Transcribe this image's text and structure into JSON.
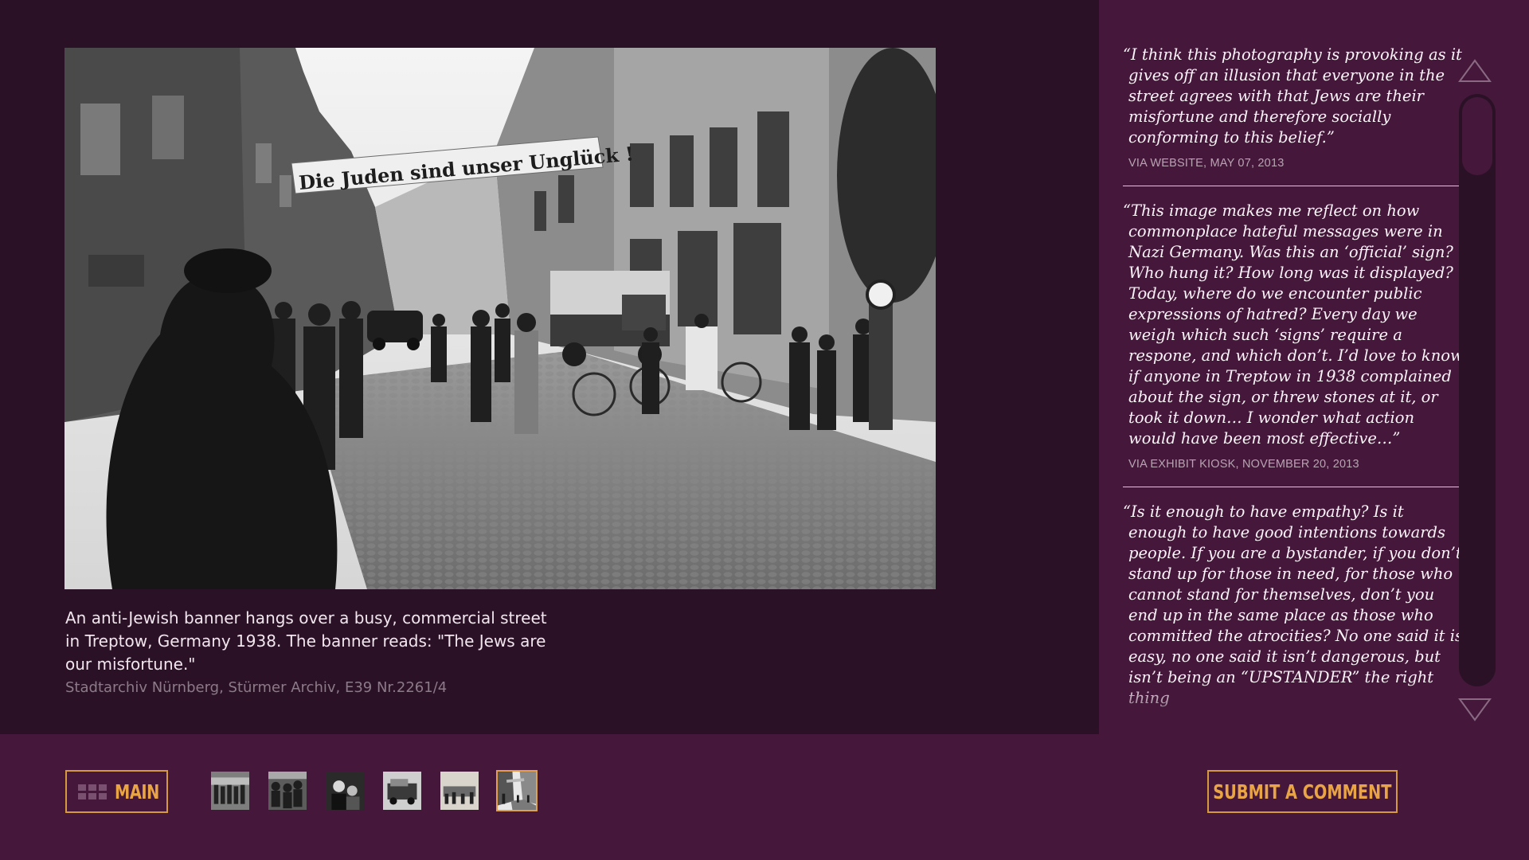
{
  "photo": {
    "banner_text": "Die Juden sind unser Unglück !"
  },
  "caption": {
    "text": "An anti-Jewish banner hangs over a busy, commercial street in Treptow, Germany 1938.  The banner reads: \"The Jews are our misfortune.\"",
    "credit": "Stadtarchiv Nürnberg, Stürmer Archiv, E39 Nr.2261/4"
  },
  "comments": [
    {
      "text": "“I think this photography is provoking as it gives off an illusion that everyone in the street agrees with that Jews are their misfortune and therefore socially conforming to this belief.”",
      "meta": "VIA WEBSITE, MAY 07, 2013"
    },
    {
      "text": "“This image makes me reflect on how commonplace hateful messages were in Nazi Germany. Was this an ‘official’ sign? Who hung it? How long was it displayed? Today, where do we encounter public expressions of hatred? Every day we weigh which such ‘signs’ require a respone, and which don’t. I’d love to know if anyone in Treptow in 1938 complained about the sign, or threw stones at it, or took it down… I wonder what action would have been most effective…”",
      "meta": "VIA EXHIBIT KIOSK, NOVEMBER 20, 2013"
    },
    {
      "text": "“Is it enough to have empathy? Is it enough to have good intentions towards people. If you are a bystander, if you don’t stand up for those in need, for those who cannot stand for themselves, don’t you end up in the same place as those who committed the atrocities? No one said it is easy, no one said it isn’t dangerous, but isn’t being an “UPSTANDER” the right thing",
      "meta": ""
    }
  ],
  "scroll": {
    "position": 0.0
  },
  "bottom_bar": {
    "main_label": "MAIN",
    "submit_label": "SUBMIT A COMMENT",
    "thumbnails_count": 6,
    "active_thumbnail": 6
  },
  "colors": {
    "background": "#2b1126",
    "panel": "#45183b",
    "accent": "#e9a545",
    "caption_text": "#f1e6ee",
    "credit_text": "#8b7a87"
  },
  "icons": [
    "grid-icon",
    "chevron-up-icon",
    "chevron-down-icon"
  ]
}
